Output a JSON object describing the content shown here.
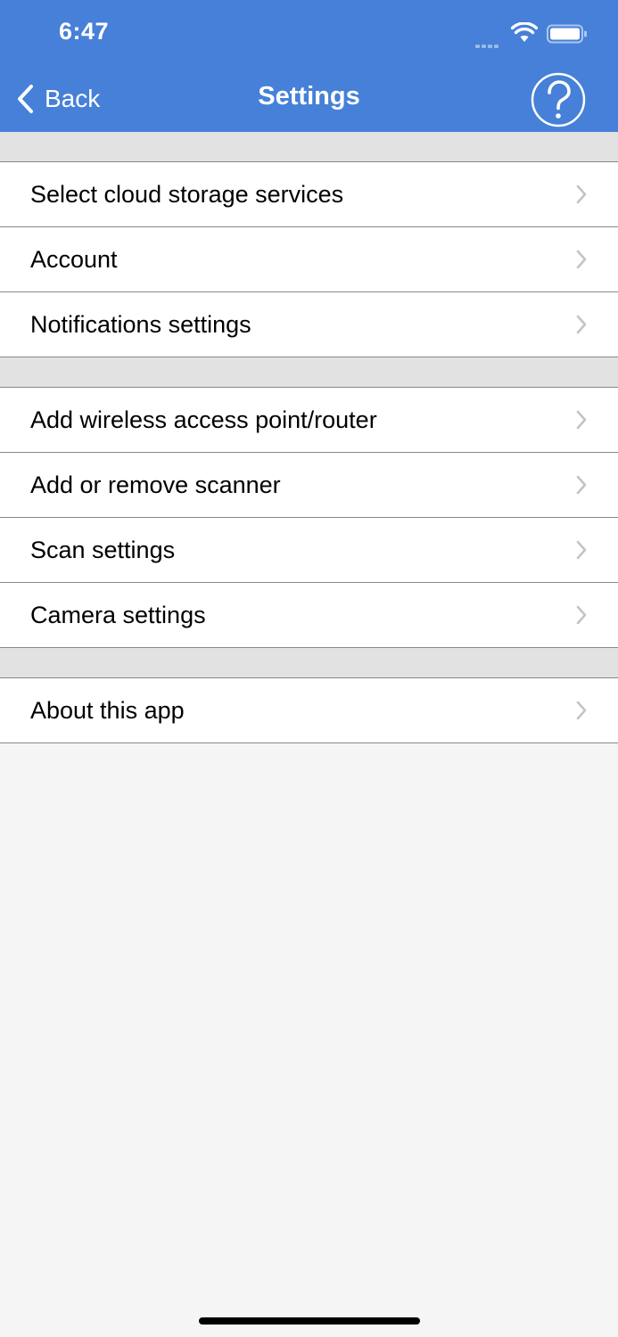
{
  "status_bar": {
    "time": "6:47"
  },
  "nav": {
    "back_label": "Back",
    "title": "Settings",
    "help_icon": "question-circle-icon",
    "accent": "#4680d8"
  },
  "sections": [
    {
      "items": [
        {
          "label": "Select cloud storage services"
        },
        {
          "label": "Account"
        },
        {
          "label": "Notifications settings"
        }
      ]
    },
    {
      "items": [
        {
          "label": "Add wireless access point/router"
        },
        {
          "label": "Add or remove scanner"
        },
        {
          "label": "Scan settings"
        },
        {
          "label": "Camera settings"
        }
      ]
    },
    {
      "items": [
        {
          "label": "About this app"
        }
      ]
    }
  ]
}
